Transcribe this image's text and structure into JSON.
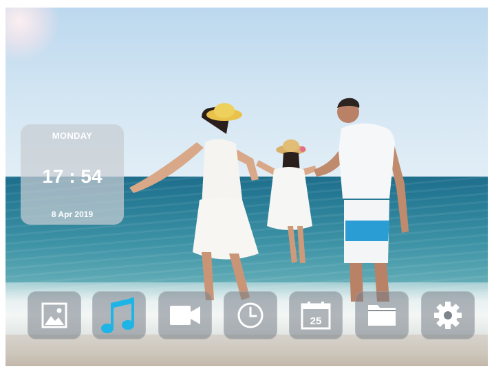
{
  "clock": {
    "day": "MONDAY",
    "time": "17 : 54",
    "date": "8 Apr 2019"
  },
  "dock": {
    "items": [
      {
        "id": "photos",
        "icon": "photo-icon",
        "active": false
      },
      {
        "id": "music",
        "icon": "music-note-icon",
        "active": true
      },
      {
        "id": "video",
        "icon": "video-camera-icon",
        "active": false
      },
      {
        "id": "clock",
        "icon": "clock-icon",
        "active": false
      },
      {
        "id": "calendar",
        "icon": "calendar-icon",
        "day_number": "25",
        "active": false
      },
      {
        "id": "files",
        "icon": "folder-icon",
        "active": false
      },
      {
        "id": "settings",
        "icon": "gear-icon",
        "active": false
      }
    ]
  },
  "colors": {
    "accent": "#1eb4e6",
    "icon": "#ffffff",
    "card": "#c8cdd2",
    "button": "#788088"
  }
}
